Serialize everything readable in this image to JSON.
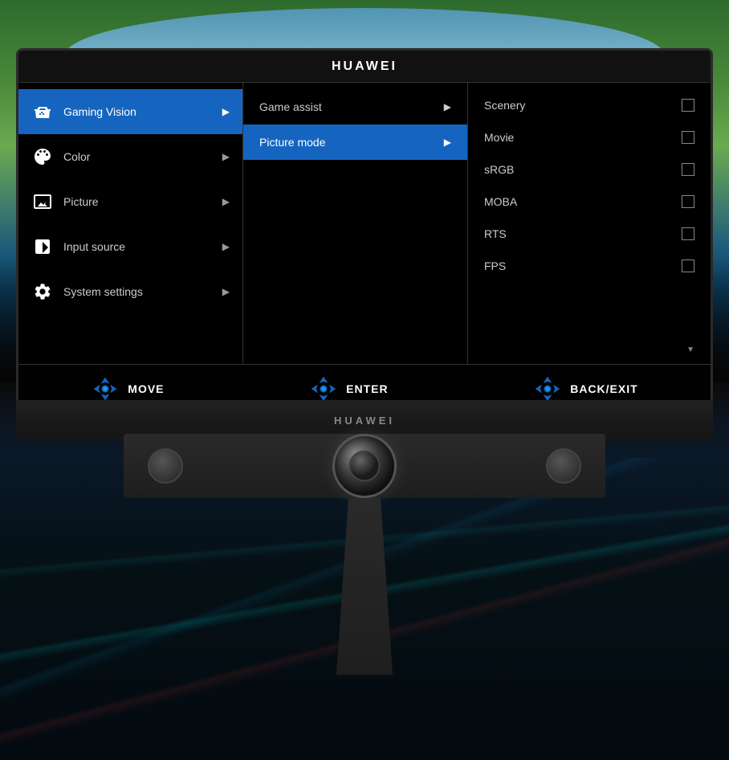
{
  "brand": "HUAWEI",
  "titlebar": {
    "label": "HUAWEI"
  },
  "menu": {
    "left": {
      "items": [
        {
          "id": "gaming-vision",
          "label": "Gaming Vision",
          "icon": "gamepad",
          "active": true,
          "hasArrow": true
        },
        {
          "id": "color",
          "label": "Color",
          "icon": "palette",
          "active": false,
          "hasArrow": true
        },
        {
          "id": "picture",
          "label": "Picture",
          "icon": "image",
          "active": false,
          "hasArrow": true
        },
        {
          "id": "input-source",
          "label": "Input source",
          "icon": "input",
          "active": false,
          "hasArrow": true
        },
        {
          "id": "system-settings",
          "label": "System settings",
          "icon": "gear",
          "active": false,
          "hasArrow": true
        }
      ]
    },
    "middle": {
      "items": [
        {
          "id": "game-assist",
          "label": "Game assist",
          "active": false,
          "hasArrow": true
        },
        {
          "id": "picture-mode",
          "label": "Picture mode",
          "active": true,
          "hasArrow": true
        }
      ]
    },
    "right": {
      "items": [
        {
          "id": "scenery",
          "label": "Scenery",
          "selected": false
        },
        {
          "id": "movie",
          "label": "Movie",
          "selected": false
        },
        {
          "id": "srgb",
          "label": "sRGB",
          "selected": false
        },
        {
          "id": "moba",
          "label": "MOBA",
          "selected": false
        },
        {
          "id": "rts",
          "label": "RTS",
          "selected": false
        },
        {
          "id": "fps",
          "label": "FPS",
          "selected": false
        }
      ],
      "hasScrollDown": true
    }
  },
  "bottomNav": {
    "move": "MOVE",
    "enter": "ENTER",
    "backExit": "BACK/EXIT"
  },
  "monitorBrand": "HUAWEI"
}
